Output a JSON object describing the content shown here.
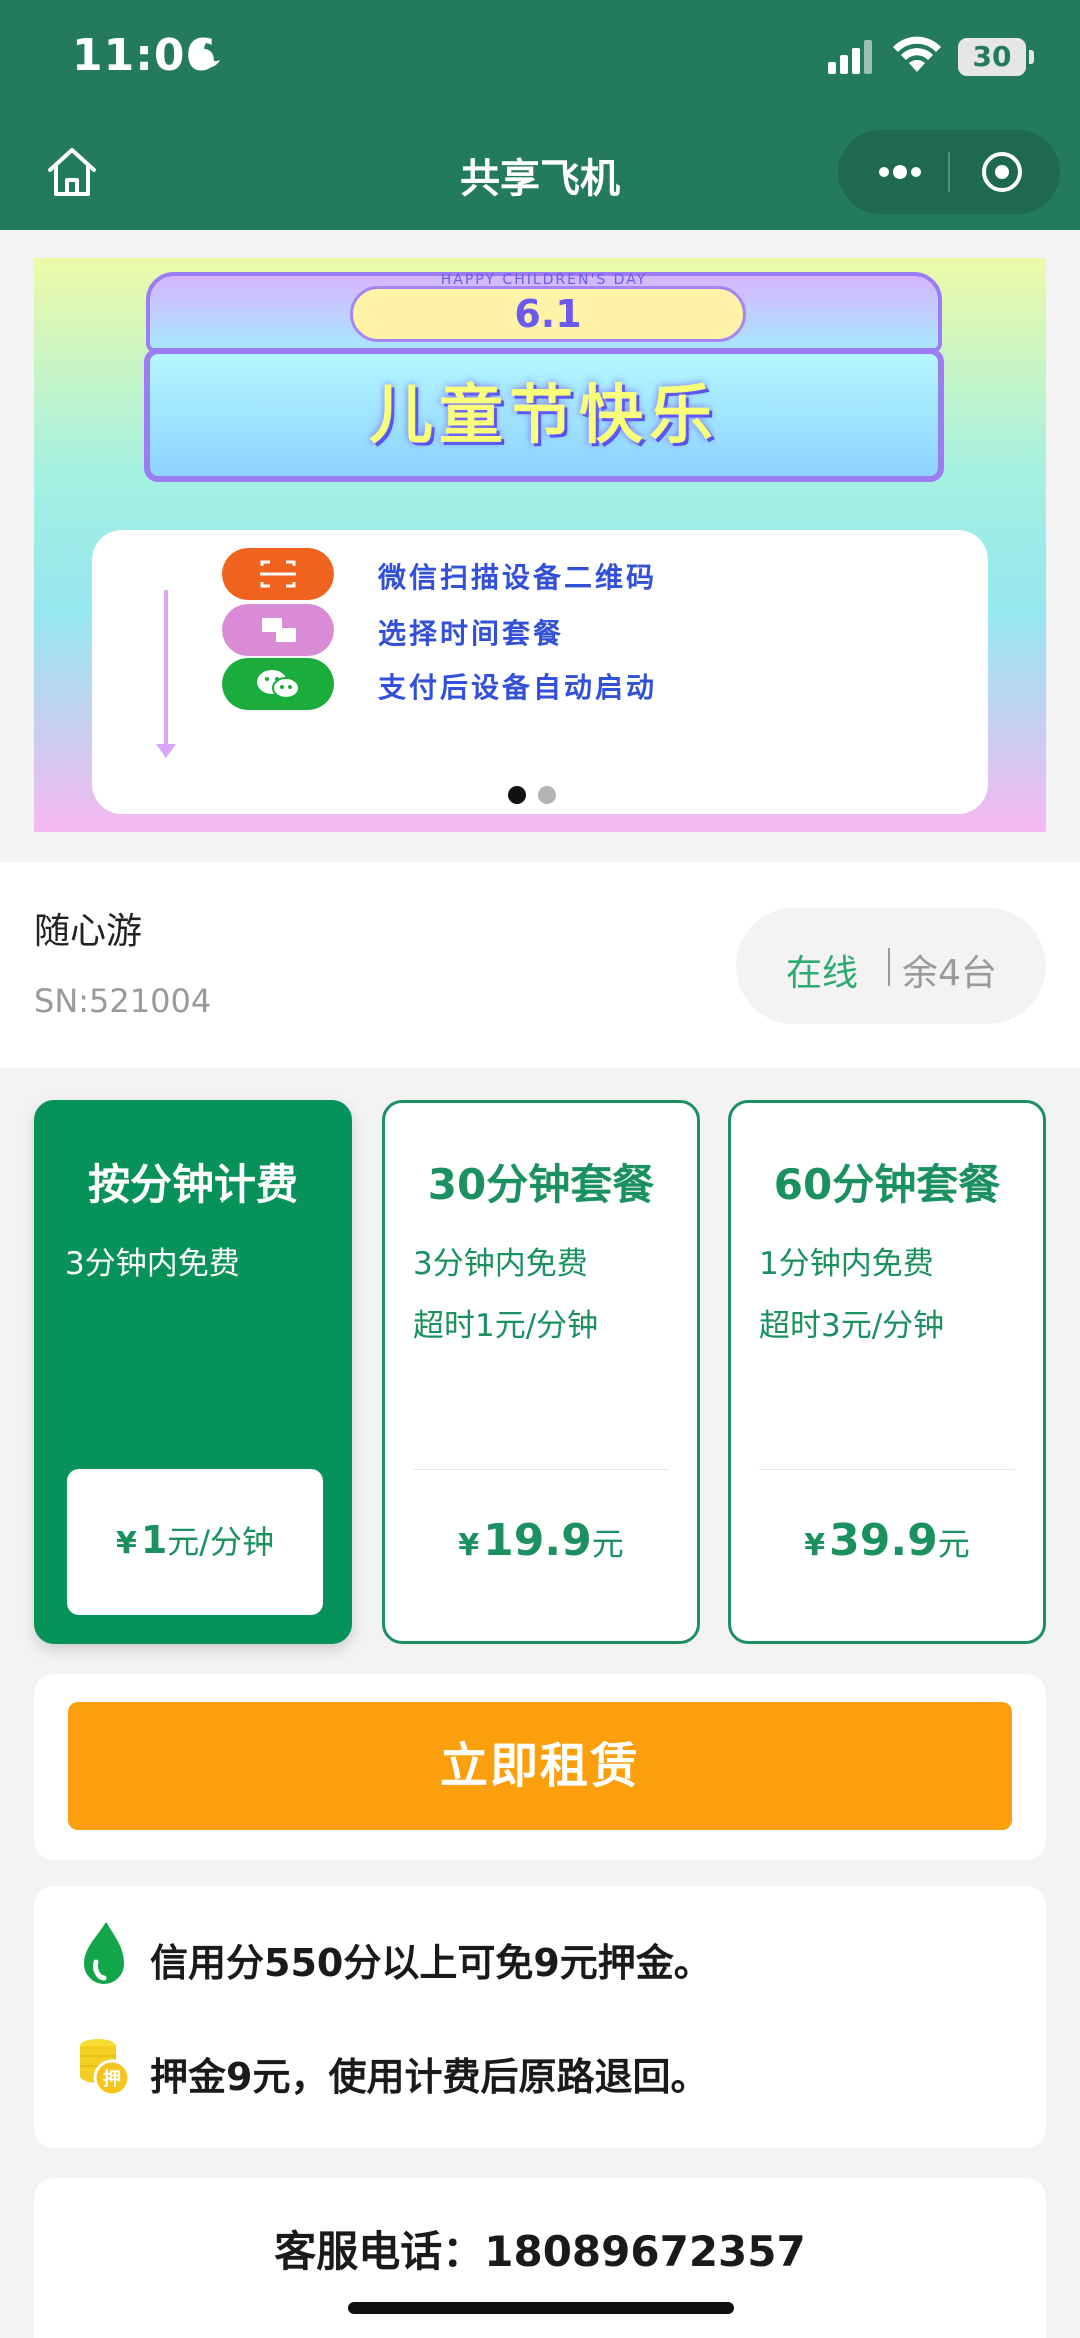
{
  "status_bar": {
    "time": "11:06",
    "battery": "30"
  },
  "nav": {
    "title": "共享飞机"
  },
  "banner": {
    "roof_text": "6.1",
    "roof_subtitle": "HAPPY CHILDREN'S DAY",
    "headline": "儿童节快乐",
    "steps": [
      {
        "text": "微信扫描设备二维码",
        "color": "#f0631f"
      },
      {
        "text": "选择时间套餐",
        "color": "#d98bd6"
      },
      {
        "text": "支付后设备自动启动",
        "color": "#1aad3c"
      }
    ],
    "page_count": 2,
    "active_page": 1
  },
  "device": {
    "name": "随心游",
    "sn": "SN:521004",
    "online": "在线",
    "remaining": "余4台"
  },
  "plans": [
    {
      "title": "按分钟计费",
      "lines": [
        "3分钟内免费"
      ],
      "yen": "¥",
      "price": "1",
      "unit": "元/分钟",
      "selected": true
    },
    {
      "title": "30分钟套餐",
      "lines": [
        "3分钟内免费",
        "超时1元/分钟"
      ],
      "yen": "¥",
      "price": "19.9",
      "unit": "元",
      "selected": false
    },
    {
      "title": "60分钟套餐",
      "lines": [
        "1分钟内免费",
        "超时3元/分钟"
      ],
      "yen": "¥",
      "price": "39.9",
      "unit": "元",
      "selected": false
    }
  ],
  "rent": {
    "button_label": "立即租赁"
  },
  "notes": [
    {
      "icon": "credit-drop-icon",
      "text": "信用分550分以上可免9元押金。"
    },
    {
      "icon": "coins-icon",
      "text": "押金9元，使用计费后原路退回。",
      "badge": "押"
    }
  ],
  "service": {
    "text": "客服电话：18089672357"
  },
  "colors": {
    "header": "#237a5c",
    "primary_green": "#07925a",
    "accent_orange": "#fc9f0c"
  }
}
